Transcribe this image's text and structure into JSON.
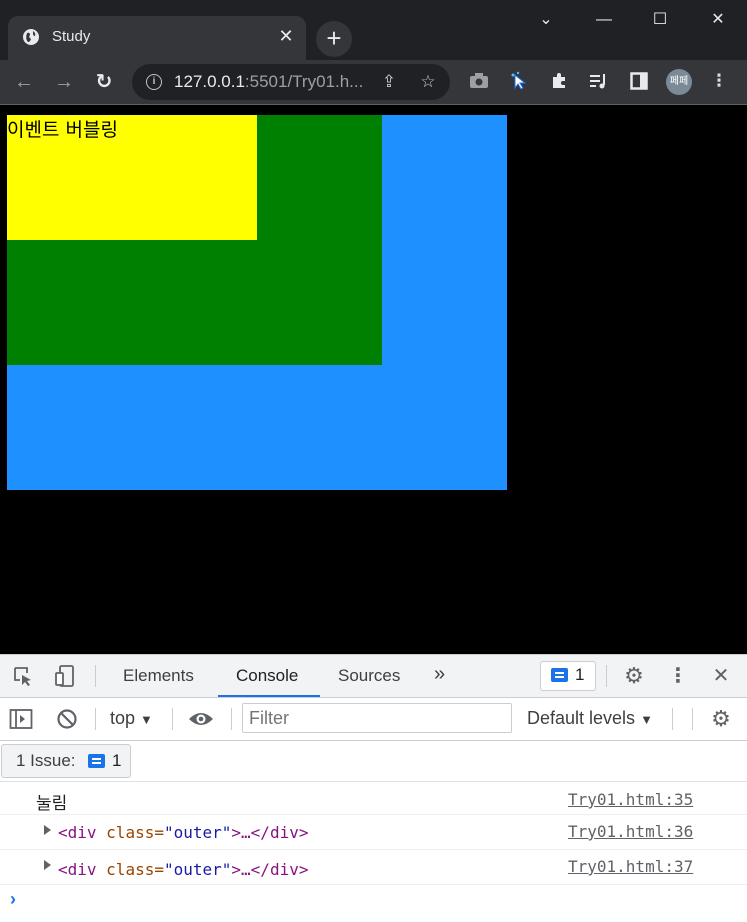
{
  "browser": {
    "tab_title": "Study",
    "tab_close": "✕",
    "new_tab": "+",
    "window_controls": {
      "minimize": "—",
      "maximize": "☐",
      "close": "✕",
      "tab_search": "⌄"
    },
    "url_host": "127.0.0.1",
    "url_rest": ":5501/Try01.h...",
    "profile_initials": "페페",
    "icons": [
      "back-icon",
      "forward-icon",
      "reload-icon",
      "info-icon",
      "share-icon",
      "star-icon",
      "camera-icon",
      "cursor-extension-icon",
      "puzzle-icon",
      "media-control-icon",
      "side-panel-icon",
      "more-vert-icon"
    ]
  },
  "page": {
    "inner_text": "이벤트 버블링",
    "colors": {
      "outer": "#1e90ff",
      "middle": "#008000",
      "inner": "#ffff00",
      "background": "#000000"
    }
  },
  "devtools": {
    "tabs": [
      "Elements",
      "Console",
      "Sources"
    ],
    "active_tab": "Console",
    "more_tabs": "»",
    "issue_badge_count": "1",
    "context": "top",
    "filter_placeholder": "Filter",
    "levels": "Default levels",
    "issues_label": "1 Issue:",
    "issues_count": "1",
    "logs": [
      {
        "text": "눌림",
        "source": "Try01.html:35"
      },
      {
        "tag_open": "<div ",
        "attr": "class=",
        "value": "\"outer\"",
        "rest": ">…</div>",
        "source": "Try01.html:36"
      },
      {
        "tag_open": "<div ",
        "attr": "class=",
        "value": "\"outer\"",
        "rest": ">…</div>",
        "source": "Try01.html:37"
      }
    ],
    "prompt": "›"
  }
}
